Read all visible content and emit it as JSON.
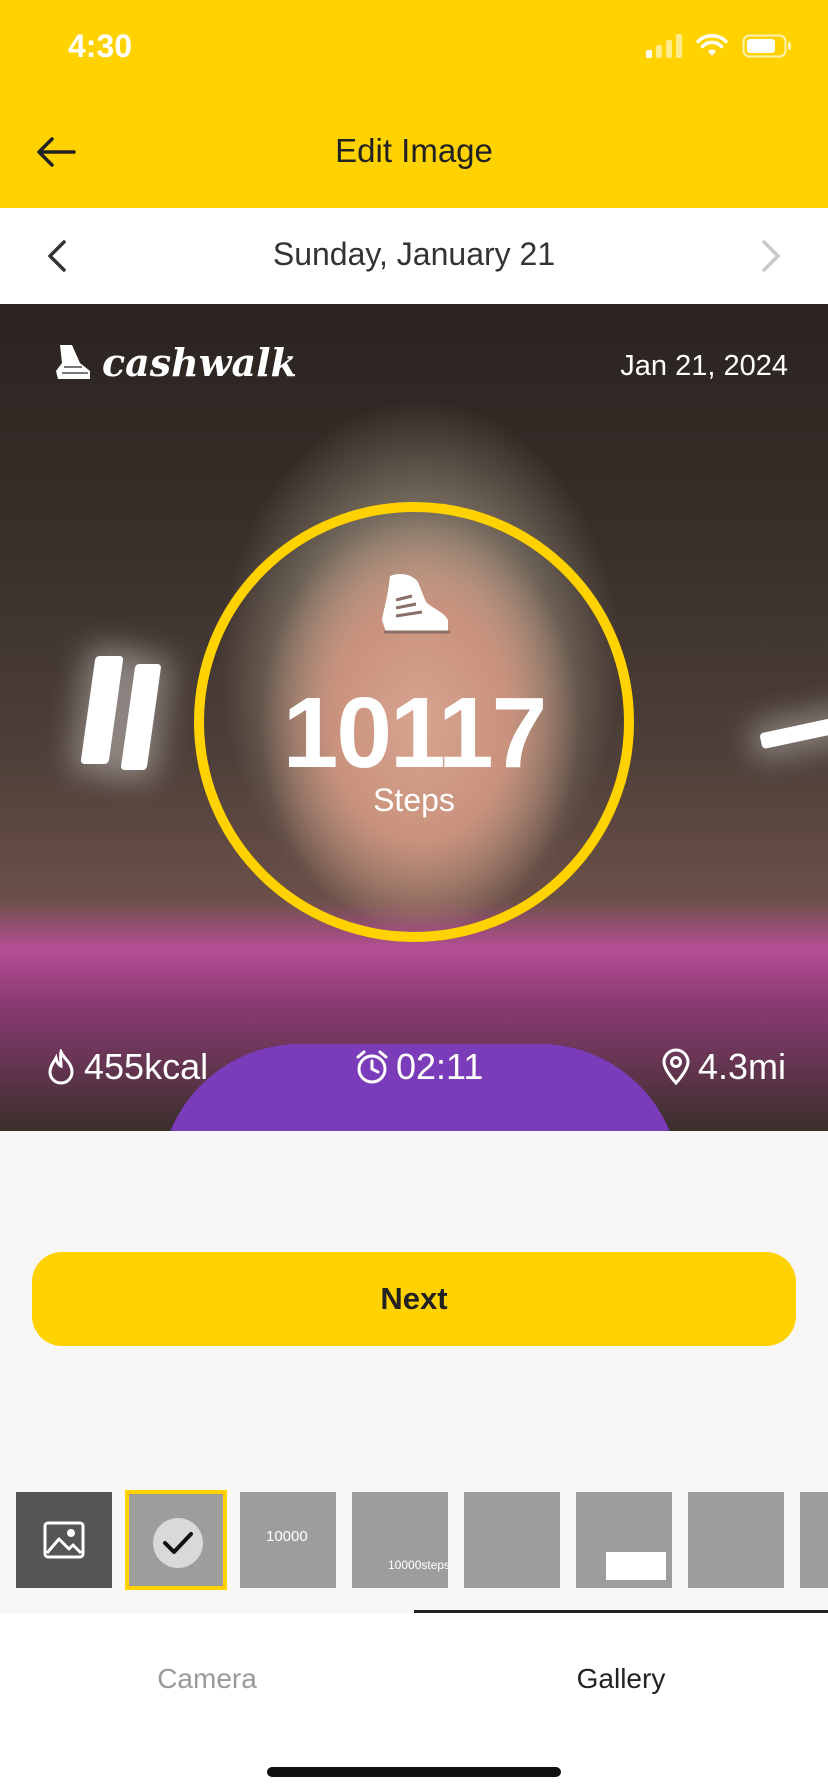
{
  "status_bar": {
    "time": "4:30"
  },
  "header": {
    "title": "Edit Image"
  },
  "date_nav": {
    "date": "Sunday, January 21"
  },
  "preview": {
    "brand": "cashwalk",
    "date": "Jan 21, 2024",
    "steps": "10117",
    "steps_label": "Steps",
    "calories": "455kcal",
    "duration": "02:11",
    "distance": "4.3mi"
  },
  "actions": {
    "next_label": "Next"
  },
  "templates": {
    "thumb_2_text": "10000",
    "thumb_3_text": "10000steps"
  },
  "tabs": [
    {
      "label": "Camera",
      "active": false
    },
    {
      "label": "Gallery",
      "active": true
    }
  ],
  "colors": {
    "accent": "#ffd200",
    "background": "#f7f7f7"
  }
}
